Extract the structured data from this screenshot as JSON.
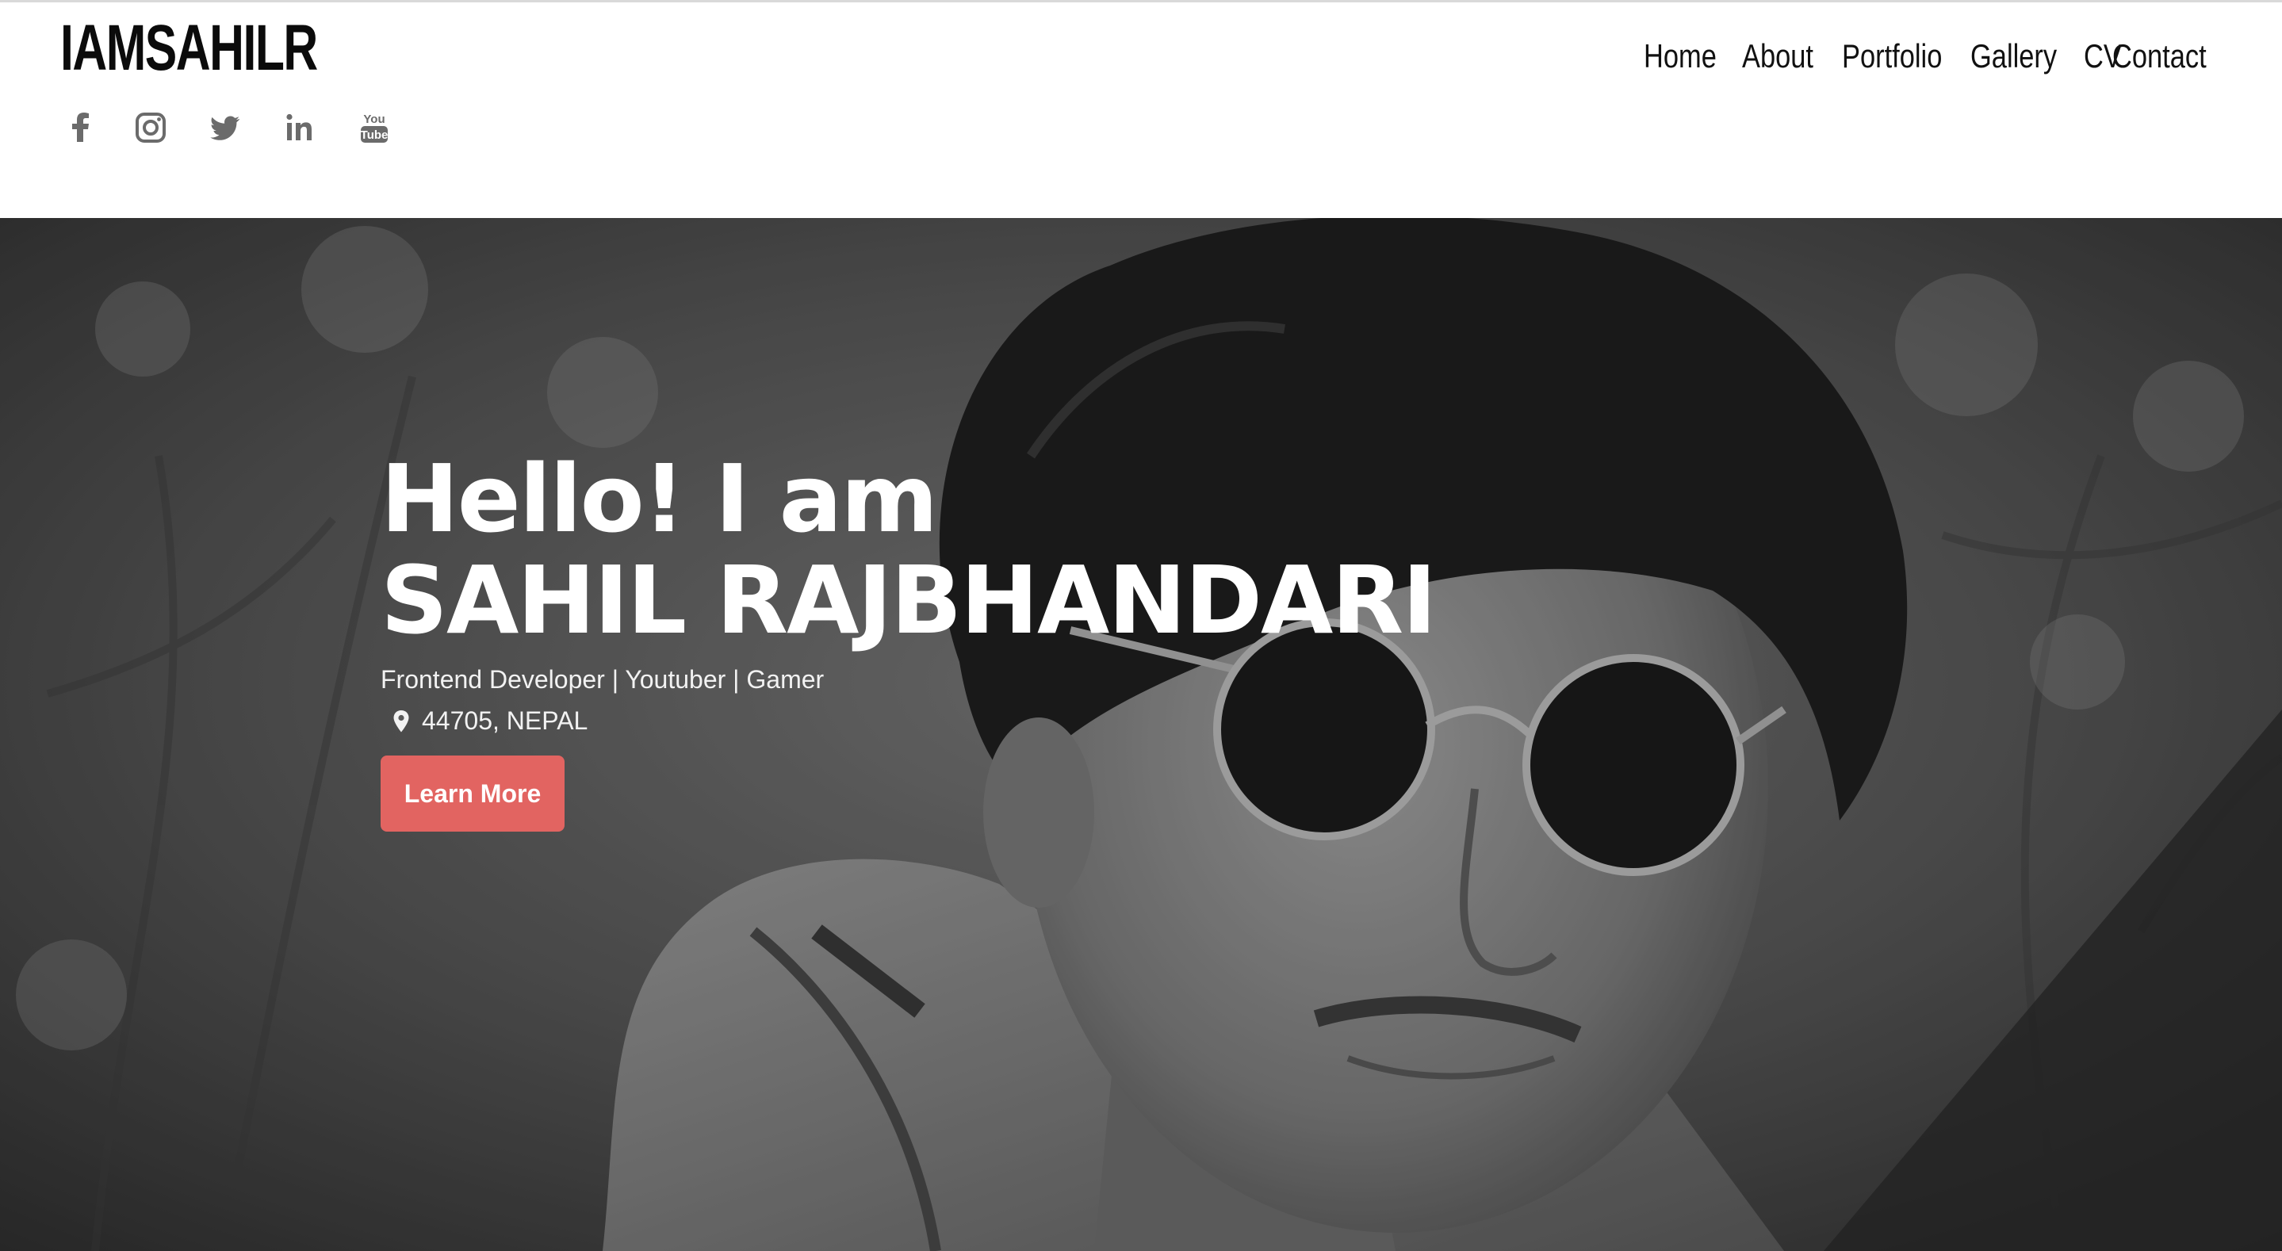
{
  "header": {
    "logo": "IAMSAHILR",
    "social": [
      {
        "name": "facebook",
        "icon": "facebook-icon"
      },
      {
        "name": "instagram",
        "icon": "instagram-icon"
      },
      {
        "name": "twitter",
        "icon": "twitter-icon"
      },
      {
        "name": "linkedin",
        "icon": "linkedin-icon"
      },
      {
        "name": "youtube",
        "icon": "youtube-icon",
        "text_line1": "You",
        "text_line2": "Tube"
      }
    ],
    "nav": [
      {
        "label": "Home"
      },
      {
        "label": "About"
      },
      {
        "label": "Portfolio"
      },
      {
        "label": "Gallery"
      },
      {
        "label": "CV"
      },
      {
        "label": "Contact"
      }
    ]
  },
  "hero": {
    "greeting": "Hello! I am",
    "name": "SAHIL RAJBHANDARI",
    "tagline": "Frontend Developer | Youtuber | Gamer",
    "location": "44705, NEPAL",
    "location_icon": "map-pin-icon",
    "button_label": "Learn More",
    "background": "black-and-white-portrait-photo"
  },
  "colors": {
    "accent": "#e26461",
    "icon_gray": "#6b6b6b",
    "text_dark": "#111111"
  }
}
